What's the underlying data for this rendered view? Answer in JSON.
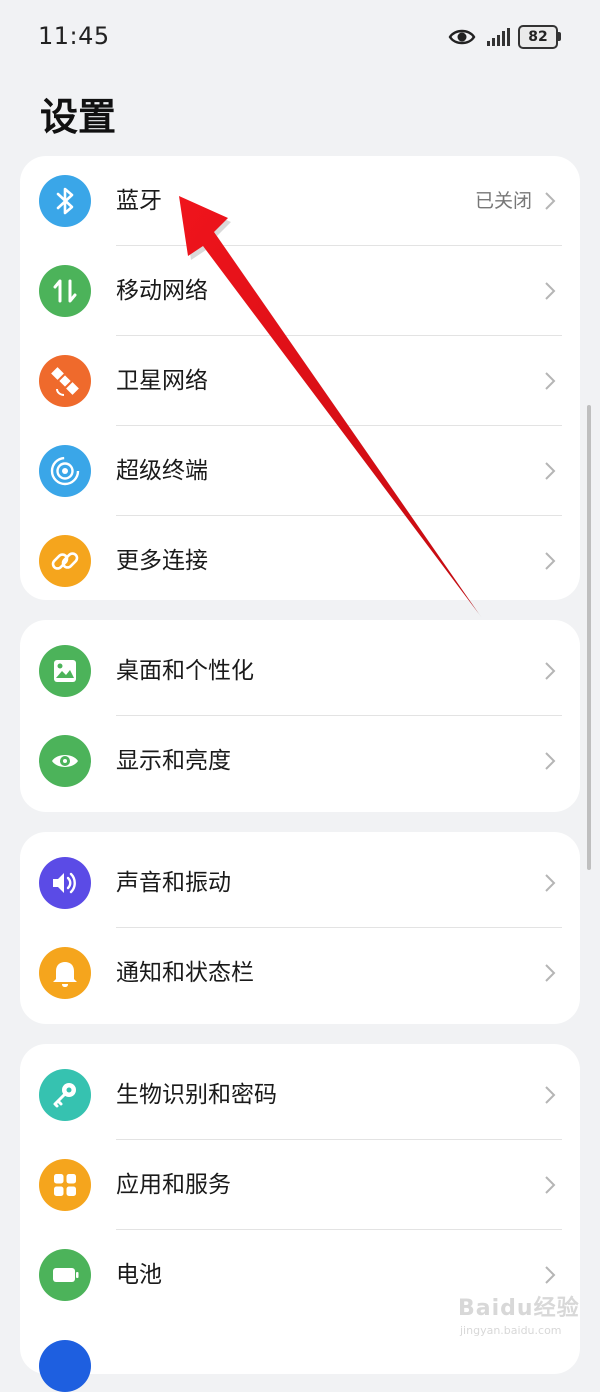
{
  "status_bar": {
    "time": "11:45",
    "battery": "82"
  },
  "page_title": "设置",
  "groups": [
    {
      "items": [
        {
          "label": "蓝牙",
          "value": "已关闭",
          "icon": "bluetooth-icon",
          "color": "#3aa6e8"
        },
        {
          "label": "移动网络",
          "icon": "mobile-data-icon",
          "color": "#4cb35a"
        },
        {
          "label": "卫星网络",
          "icon": "satellite-icon",
          "color": "#ef6a2c"
        },
        {
          "label": "超级终端",
          "icon": "super-device-icon",
          "color": "#3aa6e8"
        },
        {
          "label": "更多连接",
          "icon": "link-icon",
          "color": "#f5a51d"
        }
      ]
    },
    {
      "items": [
        {
          "label": "桌面和个性化",
          "icon": "wallpaper-icon",
          "color": "#4cb35a"
        },
        {
          "label": "显示和亮度",
          "icon": "eye-icon",
          "color": "#4cb35a"
        }
      ]
    },
    {
      "items": [
        {
          "label": "声音和振动",
          "icon": "speaker-icon",
          "color": "#5b4be6"
        },
        {
          "label": "通知和状态栏",
          "icon": "bell-icon",
          "color": "#f5a51d"
        }
      ]
    },
    {
      "items": [
        {
          "label": "生物识别和密码",
          "icon": "key-icon",
          "color": "#36c2b0"
        },
        {
          "label": "应用和服务",
          "icon": "apps-icon",
          "color": "#f5a51d"
        },
        {
          "label": "电池",
          "icon": "battery-icon",
          "color": "#4cb35a"
        }
      ]
    }
  ],
  "annotation_color": "#e8151c",
  "watermark": {
    "logo": "Baidu经验",
    "url": "jingyan.baidu.com"
  }
}
